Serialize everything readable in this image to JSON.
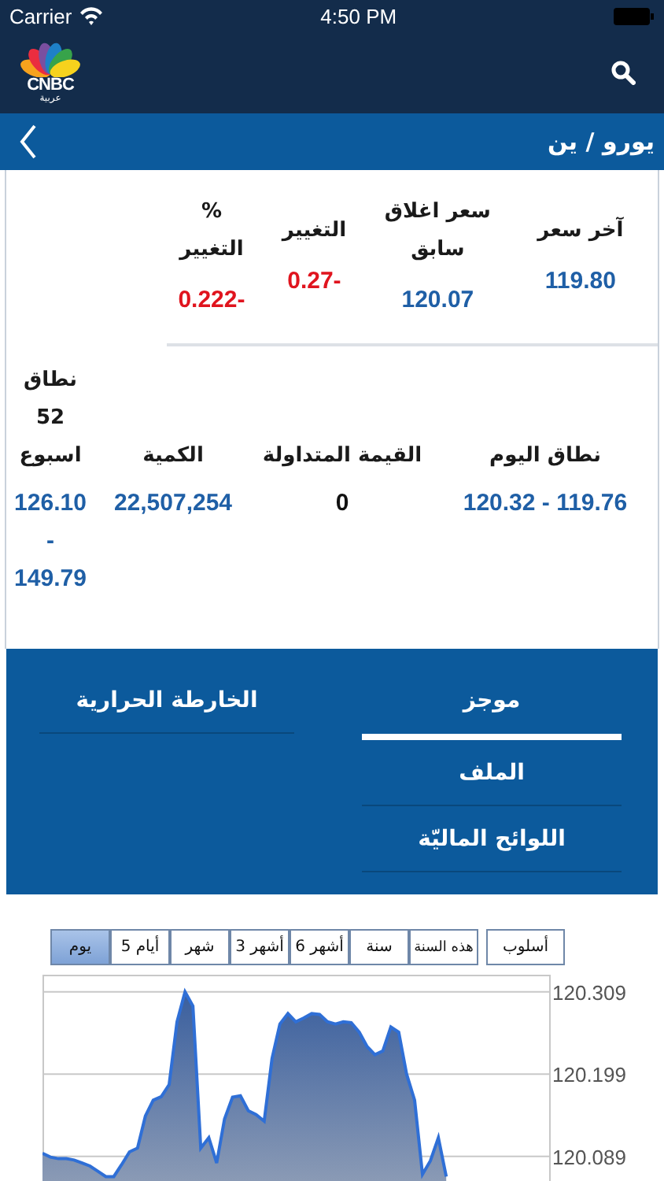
{
  "status_bar": {
    "carrier": "Carrier",
    "time": "4:50 PM"
  },
  "header": {
    "logo_text": "CNBC",
    "logo_subtitle": "عربية"
  },
  "title_bar": {
    "title": "يورو / ين"
  },
  "quote": [
    {
      "label": "آخر سعر",
      "value": "119.80",
      "kind": "neutral"
    },
    {
      "label": "سعر اغلاق سابق",
      "value": "120.07",
      "kind": "neutral"
    },
    {
      "label": "التغيير",
      "value": "0.27-",
      "kind": "negative"
    },
    {
      "label": "% التغيير",
      "value": "0.222-",
      "kind": "negative"
    }
  ],
  "stats": [
    {
      "label": "نطاق اليوم",
      "value": "120.32 - 119.76",
      "kind": "neutral"
    },
    {
      "label": "القيمة المتداولة",
      "value": "0",
      "kind": "plain"
    },
    {
      "label": "الكمية",
      "value": "22,507,254",
      "kind": "neutral"
    },
    {
      "label": "نطاق 52 اسبوع",
      "value": "126.10 - 149.79",
      "kind": "neutral"
    }
  ],
  "menu": {
    "columns": [
      [
        {
          "label": "موجز",
          "selected": true
        },
        {
          "label": "الملف",
          "selected": false
        },
        {
          "label": "اللوائح الماليّة",
          "selected": false
        }
      ],
      [
        {
          "label": "الخارطة الحرارية",
          "selected": false
        }
      ]
    ]
  },
  "chart": {
    "ranges": [
      {
        "label": "هذه السنة",
        "selected": false
      },
      {
        "label": "سنة",
        "selected": false
      },
      {
        "label": "6 أشهر",
        "selected": false
      },
      {
        "label": "3 أشهر",
        "selected": false
      },
      {
        "label": "شهر",
        "selected": false
      },
      {
        "label": "5 أيام",
        "selected": false
      },
      {
        "label": "يوم",
        "selected": true
      }
    ],
    "style_button": "أسلوب",
    "chart_data": {
      "type": "area",
      "grid": true,
      "ylim": [
        120.056,
        120.332
      ],
      "yticks": [
        {
          "value": 120.309,
          "label": "120.309"
        },
        {
          "value": 120.199,
          "label": "120.199"
        },
        {
          "value": 120.089,
          "label": "120.089"
        }
      ],
      "categories": [
        null,
        null,
        null,
        null,
        null,
        null,
        null,
        null,
        null,
        null,
        null,
        null,
        null,
        null,
        null,
        null,
        null,
        null,
        null,
        null,
        null,
        null,
        null,
        null,
        null,
        null,
        null,
        null,
        null,
        null,
        null,
        null,
        null,
        null,
        null,
        null,
        null,
        null,
        null,
        null,
        null,
        null,
        null,
        null,
        null,
        null,
        null,
        null,
        null,
        null,
        null,
        null,
        null,
        null,
        null,
        null,
        null,
        null,
        null,
        null,
        null,
        null,
        null,
        null,
        null
      ],
      "series": [
        {
          "color": "#2f6fd6",
          "values": [
            120.093,
            120.088,
            120.086,
            120.086,
            120.084,
            120.08,
            120.076,
            120.069,
            120.062,
            120.062,
            120.078,
            120.095,
            120.1,
            120.143,
            120.164,
            120.169,
            120.185,
            120.269,
            120.309,
            120.29,
            120.1,
            120.114,
            120.08,
            120.139,
            120.168,
            120.17,
            120.15,
            120.145,
            120.136,
            120.22,
            120.266,
            120.28,
            120.269,
            120.274,
            120.28,
            120.279,
            120.269,
            120.266,
            120.269,
            120.268,
            120.255,
            120.236,
            120.225,
            120.23,
            120.262,
            120.255,
            120.199,
            120.164,
            120.065,
            120.083,
            120.114,
            120.062,
            null,
            null,
            null,
            null,
            null,
            null,
            null,
            null,
            null,
            null,
            null,
            null,
            null
          ]
        }
      ]
    }
  }
}
